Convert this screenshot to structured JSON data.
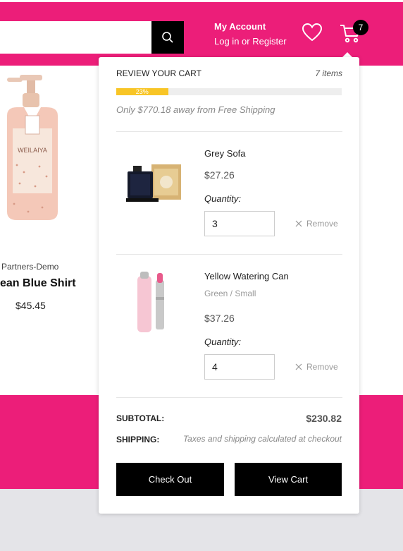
{
  "header": {
    "search_placeholder": "",
    "account_title": "My Account",
    "account_links": "Log in or Register",
    "cart_count": "7"
  },
  "product": {
    "vendor": "Partners-Demo",
    "title": "ean Blue Shirt",
    "price": "$45.45"
  },
  "cart": {
    "title": "REVIEW YOUR CART",
    "item_count": "7 items",
    "progress_percent": 23,
    "progress_label": "23%",
    "free_shipping_note": "Only $770.18 away from Free Shipping",
    "items": [
      {
        "name": "Grey Sofa",
        "variant": "",
        "price": "$27.26",
        "quantity_label": "Quantity:",
        "quantity": "3",
        "remove_label": "Remove"
      },
      {
        "name": "Yellow Watering Can",
        "variant": "Green / Small",
        "price": "$37.26",
        "quantity_label": "Quantity:",
        "quantity": "4",
        "remove_label": "Remove"
      }
    ],
    "subtotal_label": "SUBTOTAL:",
    "subtotal_value": "$230.82",
    "shipping_label": "SHIPPING:",
    "shipping_value": "Taxes and shipping calculated at checkout",
    "checkout_label": "Check Out",
    "view_cart_label": "View Cart"
  },
  "colors": {
    "brand_pink": "#ec1e79",
    "progress_fill": "#f8c526"
  }
}
